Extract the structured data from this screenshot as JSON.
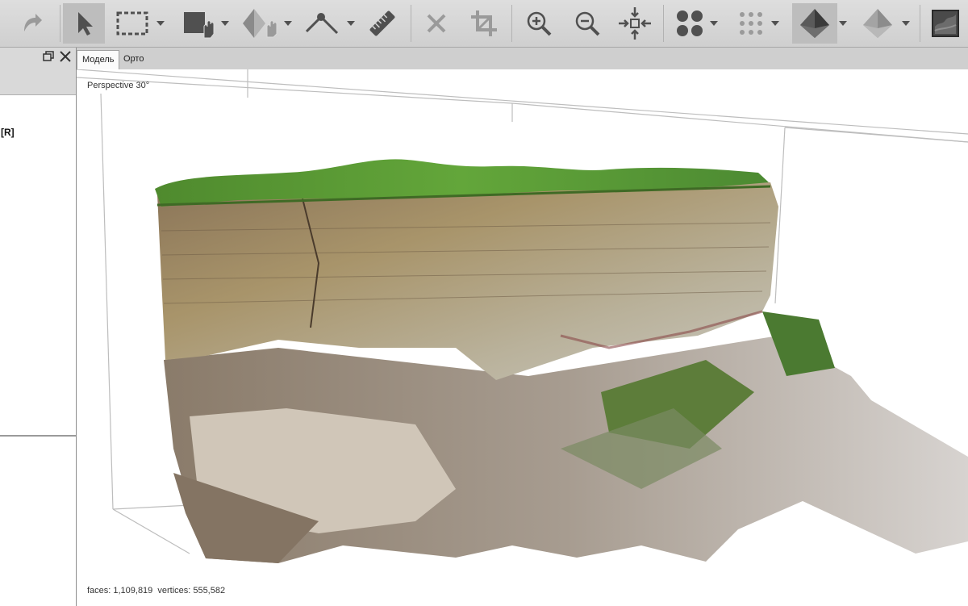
{
  "toolbar": {
    "buttons": [
      {
        "name": "redo-icon",
        "icon": "redo"
      },
      {
        "name": "select-pointer-icon",
        "icon": "pointer"
      },
      {
        "name": "rect-select-icon",
        "icon": "rect-select"
      },
      {
        "name": "area-select-icon",
        "icon": "area-select"
      },
      {
        "name": "diamond-select-icon",
        "icon": "diamond-select"
      },
      {
        "name": "measure-tool-icon",
        "icon": "measure"
      },
      {
        "name": "ruler-icon",
        "icon": "ruler"
      },
      {
        "name": "delete-icon",
        "icon": "x"
      },
      {
        "name": "crop-icon",
        "icon": "crop"
      },
      {
        "name": "zoom-in-icon",
        "icon": "zoom-in"
      },
      {
        "name": "zoom-out-icon",
        "icon": "zoom-out"
      },
      {
        "name": "reset-view-icon",
        "icon": "move"
      },
      {
        "name": "dense-points-icon",
        "icon": "dots-large"
      },
      {
        "name": "sparse-points-icon",
        "icon": "dots-small"
      },
      {
        "name": "model-solid-icon",
        "icon": "pyramid-solid"
      },
      {
        "name": "model-shaded-icon",
        "icon": "pyramid-shaded"
      },
      {
        "name": "textured-view-icon",
        "icon": "texture"
      }
    ],
    "colors": {
      "icon": "#505050",
      "disabled": "#9a9a9a"
    }
  },
  "left_panel": {
    "tag": "[R]"
  },
  "tabs": [
    {
      "label": "Модель",
      "active": true
    },
    {
      "label": "Орто",
      "active": false
    }
  ],
  "viewport": {
    "projection_label": "Perspective 30°",
    "faces_label": "faces:",
    "faces_value": "1,109,819",
    "vertices_label": "vertices:",
    "vertices_value": "555,582"
  }
}
